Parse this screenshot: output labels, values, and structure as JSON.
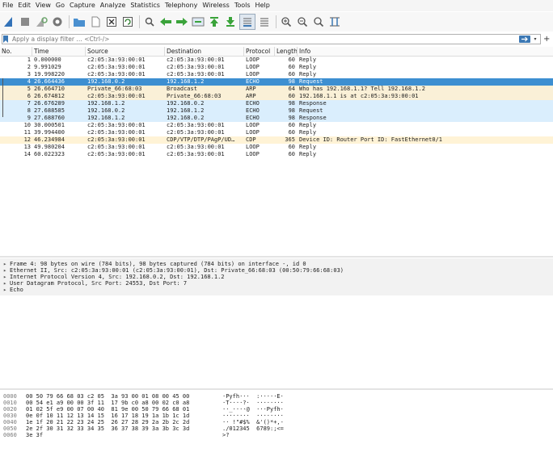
{
  "menu": [
    "File",
    "Edit",
    "View",
    "Go",
    "Capture",
    "Analyze",
    "Statistics",
    "Telephony",
    "Wireless",
    "Tools",
    "Help"
  ],
  "filter": {
    "placeholder": "Apply a display filter … <Ctrl-/>",
    "plus": "+"
  },
  "colors": {
    "selected_bg": "#3d8fd1",
    "selected_fg": "#ffffff",
    "arp_bg": "#faf0d7",
    "echo_bg": "#daeefd",
    "cdp_bg": "#fff3d6",
    "loop_bg": "#ffffff"
  },
  "toolbar_icons": [
    "shark-fin-start-icon",
    "stop-icon",
    "restart-icon",
    "options-gear-icon",
    "open-folder-icon",
    "file-icon",
    "close-file-icon",
    "reload-icon",
    "find-icon",
    "back-arrow-icon",
    "forward-arrow-icon",
    "go-to-packet-icon",
    "first-packet-icon",
    "last-packet-icon",
    "autoscroll-icon",
    "colorize-icon",
    "zoom-in-icon",
    "zoom-out-icon",
    "zoom-normal-icon",
    "resize-columns-icon"
  ],
  "columns": [
    "No.",
    "Time",
    "Source",
    "Destination",
    "Protocol",
    "Length",
    "Info"
  ],
  "packets": [
    {
      "no": "1",
      "time": "0.000000",
      "src": "c2:05:3a:93:00:01",
      "dst": "c2:05:3a:93:00:01",
      "proto": "LOOP",
      "len": "60",
      "info": "Reply",
      "kind": "loop"
    },
    {
      "no": "2",
      "time": "9.991029",
      "src": "c2:05:3a:93:00:01",
      "dst": "c2:05:3a:93:00:01",
      "proto": "LOOP",
      "len": "60",
      "info": "Reply",
      "kind": "loop"
    },
    {
      "no": "3",
      "time": "19.998220",
      "src": "c2:05:3a:93:00:01",
      "dst": "c2:05:3a:93:00:01",
      "proto": "LOOP",
      "len": "60",
      "info": "Reply",
      "kind": "loop"
    },
    {
      "no": "4",
      "time": "26.664436",
      "src": "192.168.0.2",
      "dst": "192.168.1.2",
      "proto": "ECHO",
      "len": "98",
      "info": "Request",
      "kind": "selected"
    },
    {
      "no": "5",
      "time": "26.664710",
      "src": "Private_66:68:03",
      "dst": "Broadcast",
      "proto": "ARP",
      "len": "64",
      "info": "Who has 192.168.1.1? Tell 192.168.1.2",
      "kind": "arp"
    },
    {
      "no": "6",
      "time": "26.674812",
      "src": "c2:05:3a:93:00:01",
      "dst": "Private_66:68:03",
      "proto": "ARP",
      "len": "60",
      "info": "192.168.1.1 is at c2:05:3a:93:00:01",
      "kind": "arp"
    },
    {
      "no": "7",
      "time": "26.676289",
      "src": "192.168.1.2",
      "dst": "192.168.0.2",
      "proto": "ECHO",
      "len": "98",
      "info": "Response",
      "kind": "echo"
    },
    {
      "no": "8",
      "time": "27.688585",
      "src": "192.168.0.2",
      "dst": "192.168.1.2",
      "proto": "ECHO",
      "len": "98",
      "info": "Request",
      "kind": "echo"
    },
    {
      "no": "9",
      "time": "27.688760",
      "src": "192.168.1.2",
      "dst": "192.168.0.2",
      "proto": "ECHO",
      "len": "98",
      "info": "Response",
      "kind": "echo"
    },
    {
      "no": "10",
      "time": "30.000501",
      "src": "c2:05:3a:93:00:01",
      "dst": "c2:05:3a:93:00:01",
      "proto": "LOOP",
      "len": "60",
      "info": "Reply",
      "kind": "loop"
    },
    {
      "no": "11",
      "time": "39.994400",
      "src": "c2:05:3a:93:00:01",
      "dst": "c2:05:3a:93:00:01",
      "proto": "LOOP",
      "len": "60",
      "info": "Reply",
      "kind": "loop"
    },
    {
      "no": "12",
      "time": "46.234984",
      "src": "c2:05:3a:93:00:01",
      "dst": "CDP/VTP/DTP/PAgP/UD…",
      "proto": "CDP",
      "len": "365",
      "info": "Device ID: Router  Port ID: FastEthernet0/1",
      "kind": "cdp"
    },
    {
      "no": "13",
      "time": "49.980204",
      "src": "c2:05:3a:93:00:01",
      "dst": "c2:05:3a:93:00:01",
      "proto": "LOOP",
      "len": "60",
      "info": "Reply",
      "kind": "loop"
    },
    {
      "no": "14",
      "time": "60.022323",
      "src": "c2:05:3a:93:00:01",
      "dst": "c2:05:3a:93:00:01",
      "proto": "LOOP",
      "len": "60",
      "info": "Reply",
      "kind": "loop"
    }
  ],
  "details": [
    "Frame 4: 98 bytes on wire (784 bits), 98 bytes captured (784 bits) on interface -, id 0",
    "Ethernet II, Src: c2:05:3a:93:00:01 (c2:05:3a:93:00:01), Dst: Private_66:68:03 (00:50:79:66:68:03)",
    "Internet Protocol Version 4, Src: 192.168.0.2, Dst: 192.168.1.2",
    "User Datagram Protocol, Src Port: 24553, Dst Port: 7",
    "Echo"
  ],
  "bytes": [
    {
      "off": "0000",
      "hex": "00 50 79 66 68 03 c2 05  3a 93 00 01 08 00 45 00",
      "ascii": "·Pyfh···  :·····E·"
    },
    {
      "off": "0010",
      "hex": "00 54 e1 a9 00 00 3f 11  17 9b c0 a8 00 02 c0 a8",
      "ascii": "·T····?·  ········"
    },
    {
      "off": "0020",
      "hex": "01 02 5f e9 00 07 00 40  81 9e 00 50 79 66 68 01",
      "ascii": "··_····@  ···Pyfh·"
    },
    {
      "off": "0030",
      "hex": "0e 0f 10 11 12 13 14 15  16 17 18 19 1a 1b 1c 1d",
      "ascii": "········  ········"
    },
    {
      "off": "0040",
      "hex": "1e 1f 20 21 22 23 24 25  26 27 28 29 2a 2b 2c 2d",
      "ascii": "·· !\"#$%  &'()*+,-"
    },
    {
      "off": "0050",
      "hex": "2e 2f 30 31 32 33 34 35  36 37 38 39 3a 3b 3c 3d",
      "ascii": "./012345  6789:;<="
    },
    {
      "off": "0060",
      "hex": "3e 3f",
      "ascii": ">?"
    }
  ]
}
